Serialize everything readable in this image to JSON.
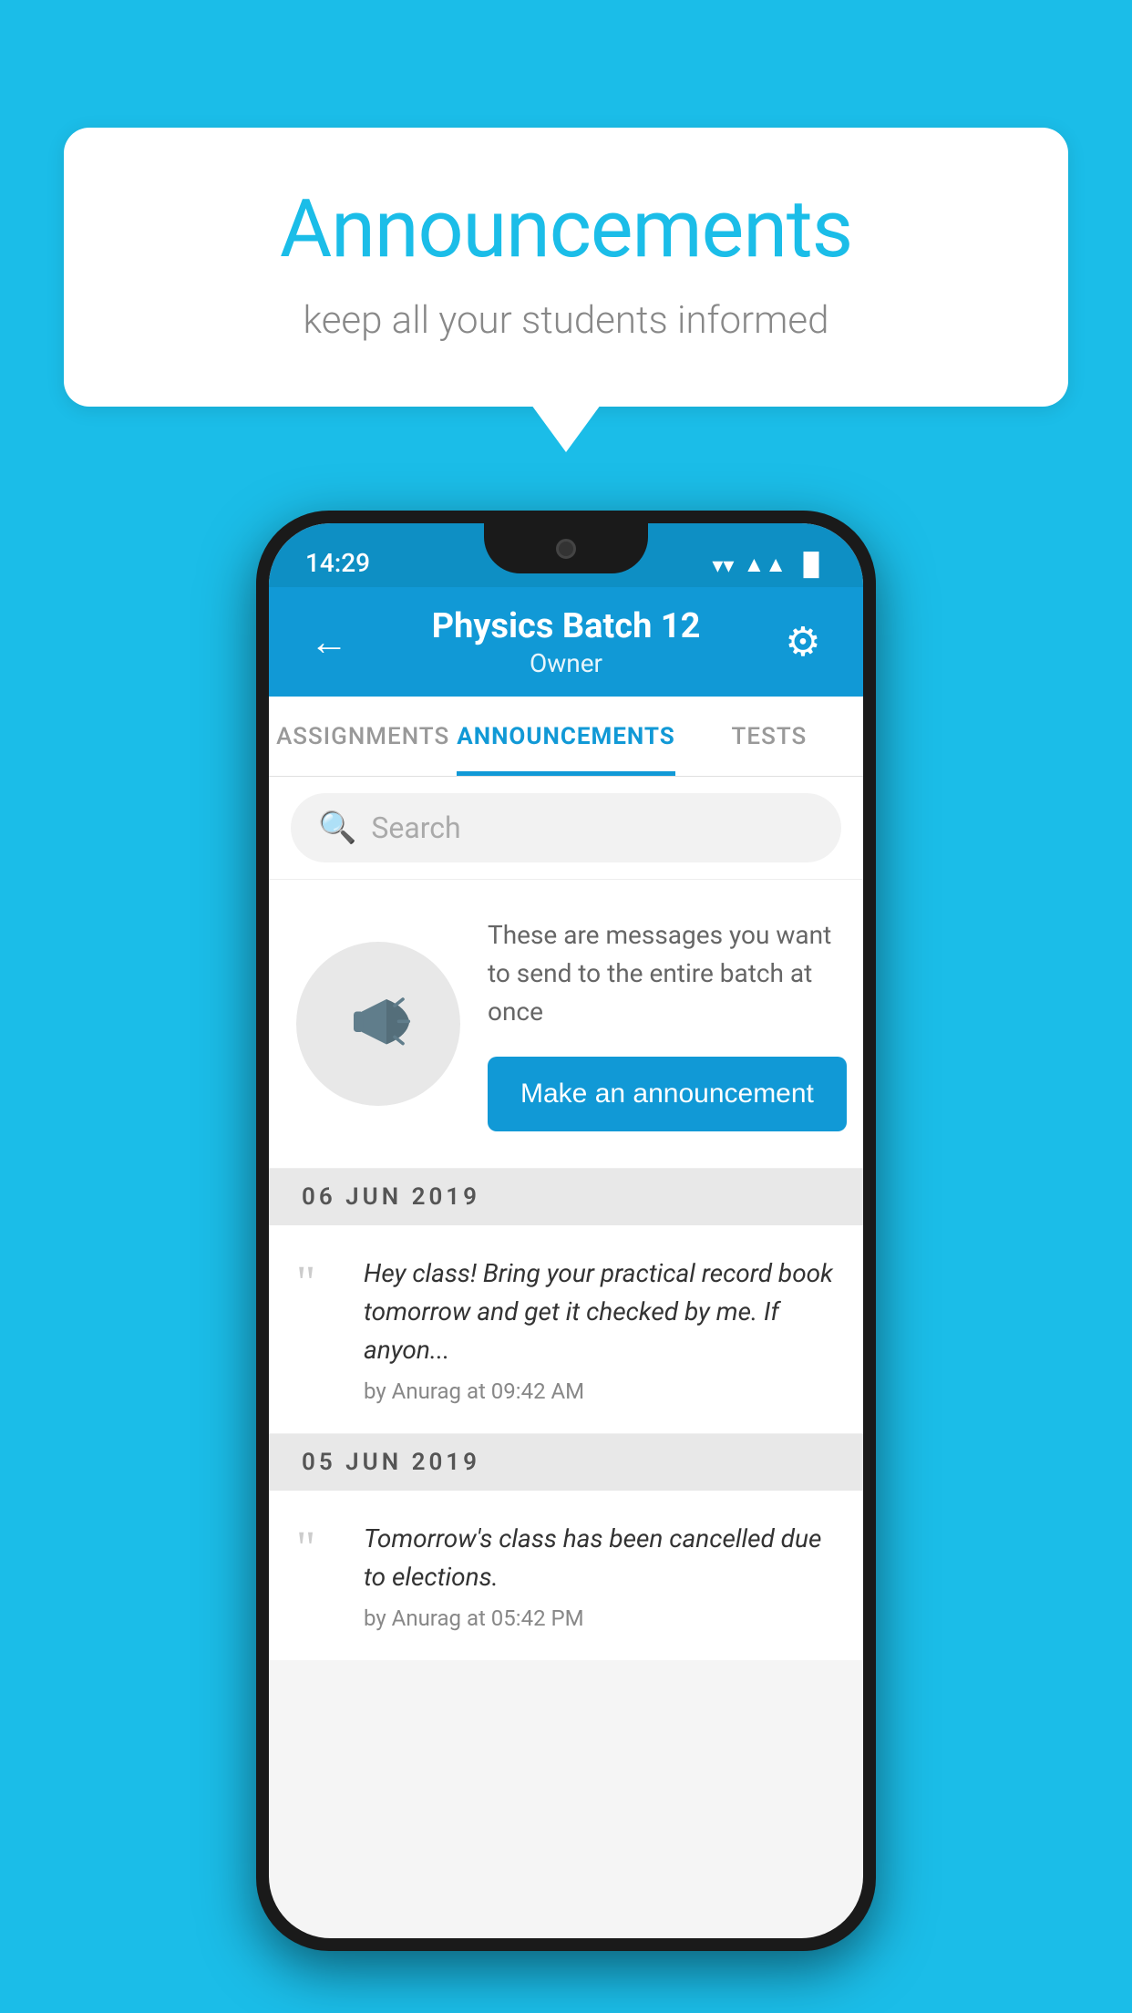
{
  "background_color": "#1BBDE8",
  "speech_bubble": {
    "title": "Announcements",
    "subtitle": "keep all your students informed"
  },
  "phone": {
    "status_bar": {
      "time": "14:29",
      "wifi": "▼",
      "signal": "▲",
      "battery": "▌"
    },
    "app_bar": {
      "back_label": "←",
      "title": "Physics Batch 12",
      "subtitle": "Owner",
      "settings_label": "⚙"
    },
    "tabs": [
      {
        "label": "ASSIGNMENTS",
        "active": false
      },
      {
        "label": "ANNOUNCEMENTS",
        "active": true
      },
      {
        "label": "TESTS",
        "active": false
      }
    ],
    "search": {
      "placeholder": "Search"
    },
    "promo": {
      "description": "These are messages you want to send to the entire batch at once",
      "button_label": "Make an announcement"
    },
    "announcements": [
      {
        "date": "06  JUN  2019",
        "message": "Hey class! Bring your practical record book tomorrow and get it checked by me. If anyon...",
        "meta": "by Anurag at 09:42 AM"
      },
      {
        "date": "05  JUN  2019",
        "message": "Tomorrow's class has been cancelled due to elections.",
        "meta": "by Anurag at 05:42 PM"
      }
    ]
  }
}
